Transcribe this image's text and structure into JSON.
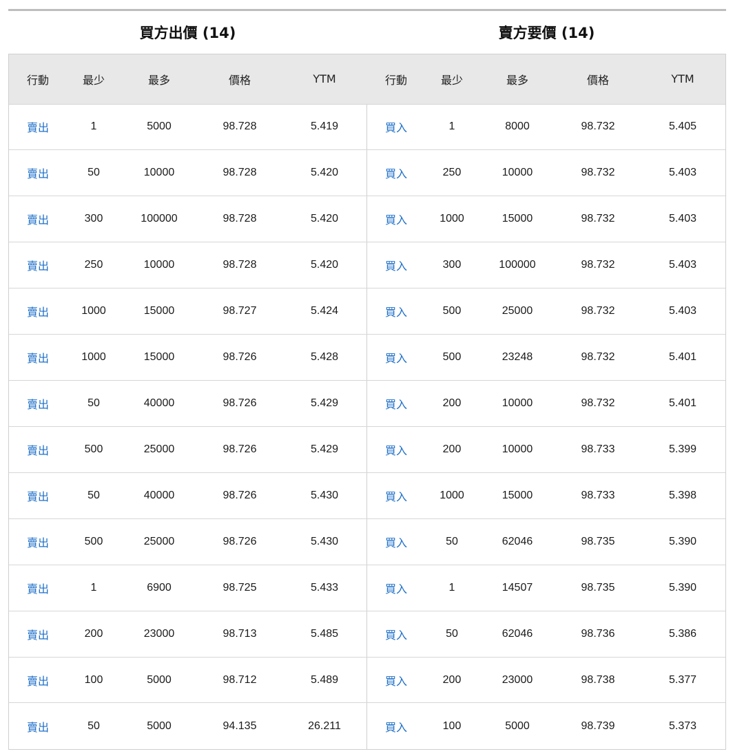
{
  "bid": {
    "title": "買方出價 (14)",
    "headers": [
      "行動",
      "最少",
      "最多",
      "價格",
      "YTM"
    ],
    "rows": [
      {
        "action": "賣出",
        "min": "1",
        "max": "5000",
        "price": "98.728",
        "ytm": "5.419"
      },
      {
        "action": "賣出",
        "min": "50",
        "max": "10000",
        "price": "98.728",
        "ytm": "5.420"
      },
      {
        "action": "賣出",
        "min": "300",
        "max": "100000",
        "price": "98.728",
        "ytm": "5.420"
      },
      {
        "action": "賣出",
        "min": "250",
        "max": "10000",
        "price": "98.728",
        "ytm": "5.420"
      },
      {
        "action": "賣出",
        "min": "1000",
        "max": "15000",
        "price": "98.727",
        "ytm": "5.424"
      },
      {
        "action": "賣出",
        "min": "1000",
        "max": "15000",
        "price": "98.726",
        "ytm": "5.428"
      },
      {
        "action": "賣出",
        "min": "50",
        "max": "40000",
        "price": "98.726",
        "ytm": "5.429"
      },
      {
        "action": "賣出",
        "min": "500",
        "max": "25000",
        "price": "98.726",
        "ytm": "5.429"
      },
      {
        "action": "賣出",
        "min": "50",
        "max": "40000",
        "price": "98.726",
        "ytm": "5.430"
      },
      {
        "action": "賣出",
        "min": "500",
        "max": "25000",
        "price": "98.726",
        "ytm": "5.430"
      },
      {
        "action": "賣出",
        "min": "1",
        "max": "6900",
        "price": "98.725",
        "ytm": "5.433"
      },
      {
        "action": "賣出",
        "min": "200",
        "max": "23000",
        "price": "98.713",
        "ytm": "5.485"
      },
      {
        "action": "賣出",
        "min": "100",
        "max": "5000",
        "price": "98.712",
        "ytm": "5.489"
      },
      {
        "action": "賣出",
        "min": "50",
        "max": "5000",
        "price": "94.135",
        "ytm": "26.211"
      }
    ]
  },
  "ask": {
    "title": "賣方要價 (14)",
    "headers": [
      "行動",
      "最少",
      "最多",
      "價格",
      "YTM"
    ],
    "rows": [
      {
        "action": "買入",
        "min": "1",
        "max": "8000",
        "price": "98.732",
        "ytm": "5.405"
      },
      {
        "action": "買入",
        "min": "250",
        "max": "10000",
        "price": "98.732",
        "ytm": "5.403"
      },
      {
        "action": "買入",
        "min": "1000",
        "max": "15000",
        "price": "98.732",
        "ytm": "5.403"
      },
      {
        "action": "買入",
        "min": "300",
        "max": "100000",
        "price": "98.732",
        "ytm": "5.403"
      },
      {
        "action": "買入",
        "min": "500",
        "max": "25000",
        "price": "98.732",
        "ytm": "5.403"
      },
      {
        "action": "買入",
        "min": "500",
        "max": "23248",
        "price": "98.732",
        "ytm": "5.401"
      },
      {
        "action": "買入",
        "min": "200",
        "max": "10000",
        "price": "98.732",
        "ytm": "5.401"
      },
      {
        "action": "買入",
        "min": "200",
        "max": "10000",
        "price": "98.733",
        "ytm": "5.399"
      },
      {
        "action": "買入",
        "min": "1000",
        "max": "15000",
        "price": "98.733",
        "ytm": "5.398"
      },
      {
        "action": "買入",
        "min": "50",
        "max": "62046",
        "price": "98.735",
        "ytm": "5.390"
      },
      {
        "action": "買入",
        "min": "1",
        "max": "14507",
        "price": "98.735",
        "ytm": "5.390"
      },
      {
        "action": "買入",
        "min": "50",
        "max": "62046",
        "price": "98.736",
        "ytm": "5.386"
      },
      {
        "action": "買入",
        "min": "200",
        "max": "23000",
        "price": "98.738",
        "ytm": "5.377"
      },
      {
        "action": "買入",
        "min": "100",
        "max": "5000",
        "price": "98.739",
        "ytm": "5.373"
      }
    ]
  },
  "colors": {
    "action_link": "#1e6fc9",
    "header_bg": "#e8e8e8",
    "border": "#cfcfcf"
  }
}
